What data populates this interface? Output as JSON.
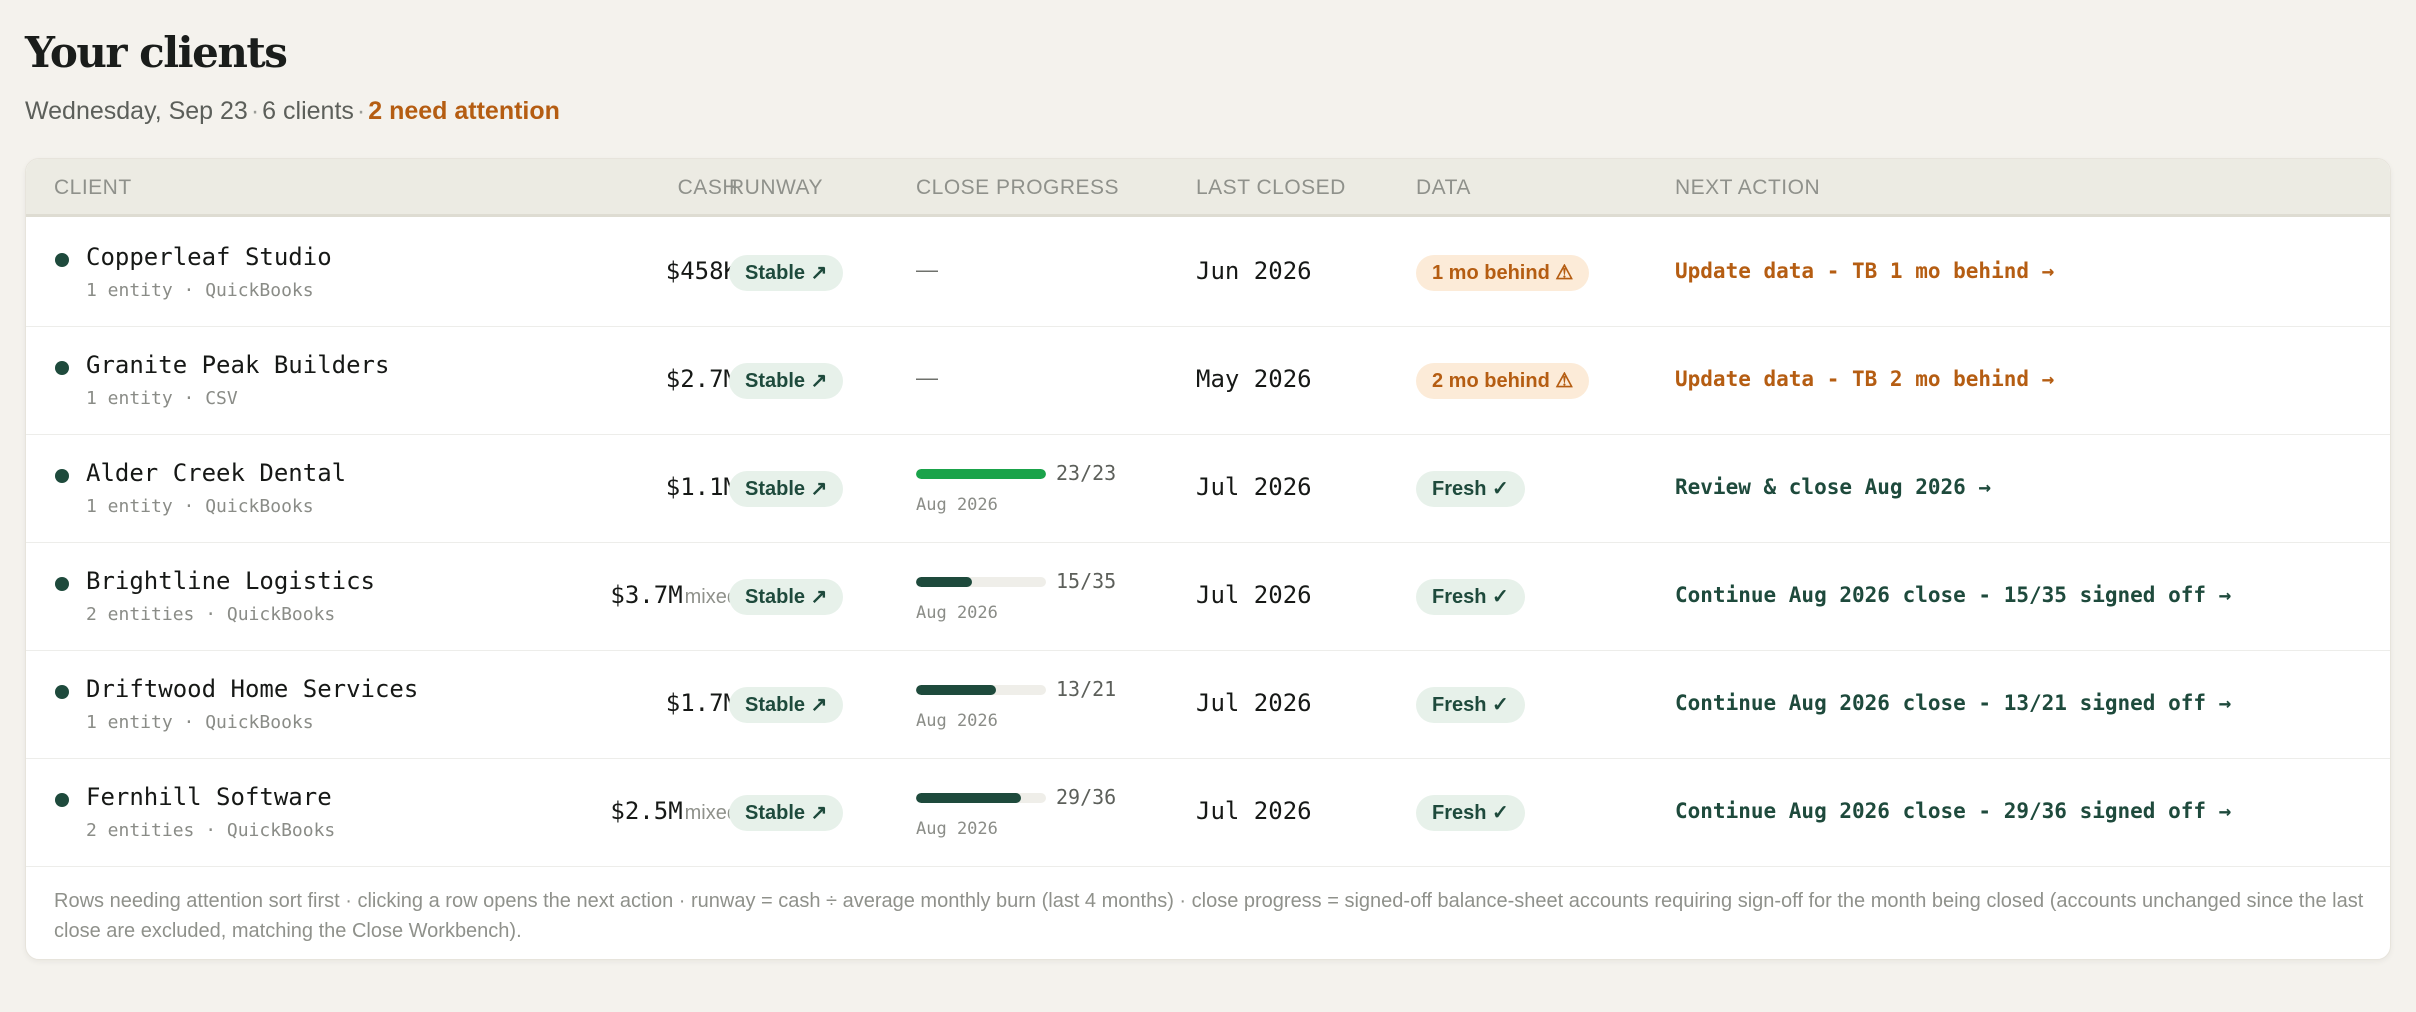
{
  "page": {
    "title": "Your clients",
    "date": "Wednesday, Sep 23",
    "separator": "·",
    "client_count": "6 clients",
    "attention": "2 need attention"
  },
  "table": {
    "headers": {
      "client": "CLIENT",
      "cash": "CASH",
      "runway": "RUNWAY",
      "close_progress": "CLOSE PROGRESS",
      "last_closed": "LAST CLOSED",
      "data": "DATA",
      "next_action": "NEXT ACTION"
    },
    "rows": [
      {
        "name": "Copperleaf Studio",
        "meta": "1 entity · QuickBooks",
        "cash": "$458K",
        "cash_note": "",
        "runway": "Stable ↗",
        "progress": null,
        "progress_dash": "—",
        "last_closed": "Jun 2026",
        "data_status": "1 mo behind ⚠",
        "data_kind": "behind",
        "next_action": "Update data - TB 1 mo behind →"
      },
      {
        "name": "Granite Peak Builders",
        "meta": "1 entity · CSV",
        "cash": "$2.7M",
        "cash_note": "",
        "runway": "Stable ↗",
        "progress": null,
        "progress_dash": "—",
        "last_closed": "May 2026",
        "data_status": "2 mo behind ⚠",
        "data_kind": "behind",
        "next_action": "Update data - TB 2 mo behind →"
      },
      {
        "name": "Alder Creek Dental",
        "meta": "1 entity · QuickBooks",
        "cash": "$1.1M",
        "cash_note": "",
        "runway": "Stable ↗",
        "progress": {
          "done": 23,
          "total": 23,
          "label": "23/23",
          "month": "Aug 2026"
        },
        "last_closed": "Jul 2026",
        "data_status": "Fresh ✓",
        "data_kind": "fresh",
        "next_action": "Review & close Aug 2026 →"
      },
      {
        "name": "Brightline Logistics",
        "meta": "2 entities · QuickBooks",
        "cash": "$3.7M",
        "cash_note": "mixed",
        "runway": "Stable ↗",
        "progress": {
          "done": 15,
          "total": 35,
          "label": "15/35",
          "month": "Aug 2026"
        },
        "last_closed": "Jul 2026",
        "data_status": "Fresh ✓",
        "data_kind": "fresh",
        "next_action": "Continue Aug 2026 close - 15/35 signed off →"
      },
      {
        "name": "Driftwood Home Services",
        "meta": "1 entity · QuickBooks",
        "cash": "$1.7M",
        "cash_note": "",
        "runway": "Stable ↗",
        "progress": {
          "done": 13,
          "total": 21,
          "label": "13/21",
          "month": "Aug 2026"
        },
        "last_closed": "Jul 2026",
        "data_status": "Fresh ✓",
        "data_kind": "fresh",
        "next_action": "Continue Aug 2026 close - 13/21 signed off →"
      },
      {
        "name": "Fernhill Software",
        "meta": "2 entities · QuickBooks",
        "cash": "$2.5M",
        "cash_note": "mixed",
        "runway": "Stable ↗",
        "progress": {
          "done": 29,
          "total": 36,
          "label": "29/36",
          "month": "Aug 2026"
        },
        "last_closed": "Jul 2026",
        "data_status": "Fresh ✓",
        "data_kind": "fresh",
        "next_action": "Continue Aug 2026 close - 29/36 signed off →"
      }
    ],
    "footnote": "Rows needing attention sort first · clicking a row opens the next action · runway = cash ÷ average monthly burn (last 4 months) · close progress = signed-off balance-sheet accounts requiring sign-off for the month being closed (accounts unchanged since the last close are excluded, matching the Close Workbench)."
  },
  "colors": {
    "accent_green": "#1e4a3c",
    "complete_green": "#1aa34a",
    "warning_orange": "#b55d12",
    "badge_green_bg": "#e7f1ea",
    "badge_orange_bg": "#fcebd8"
  },
  "icons": {
    "status_dot": "status-dot-icon"
  }
}
